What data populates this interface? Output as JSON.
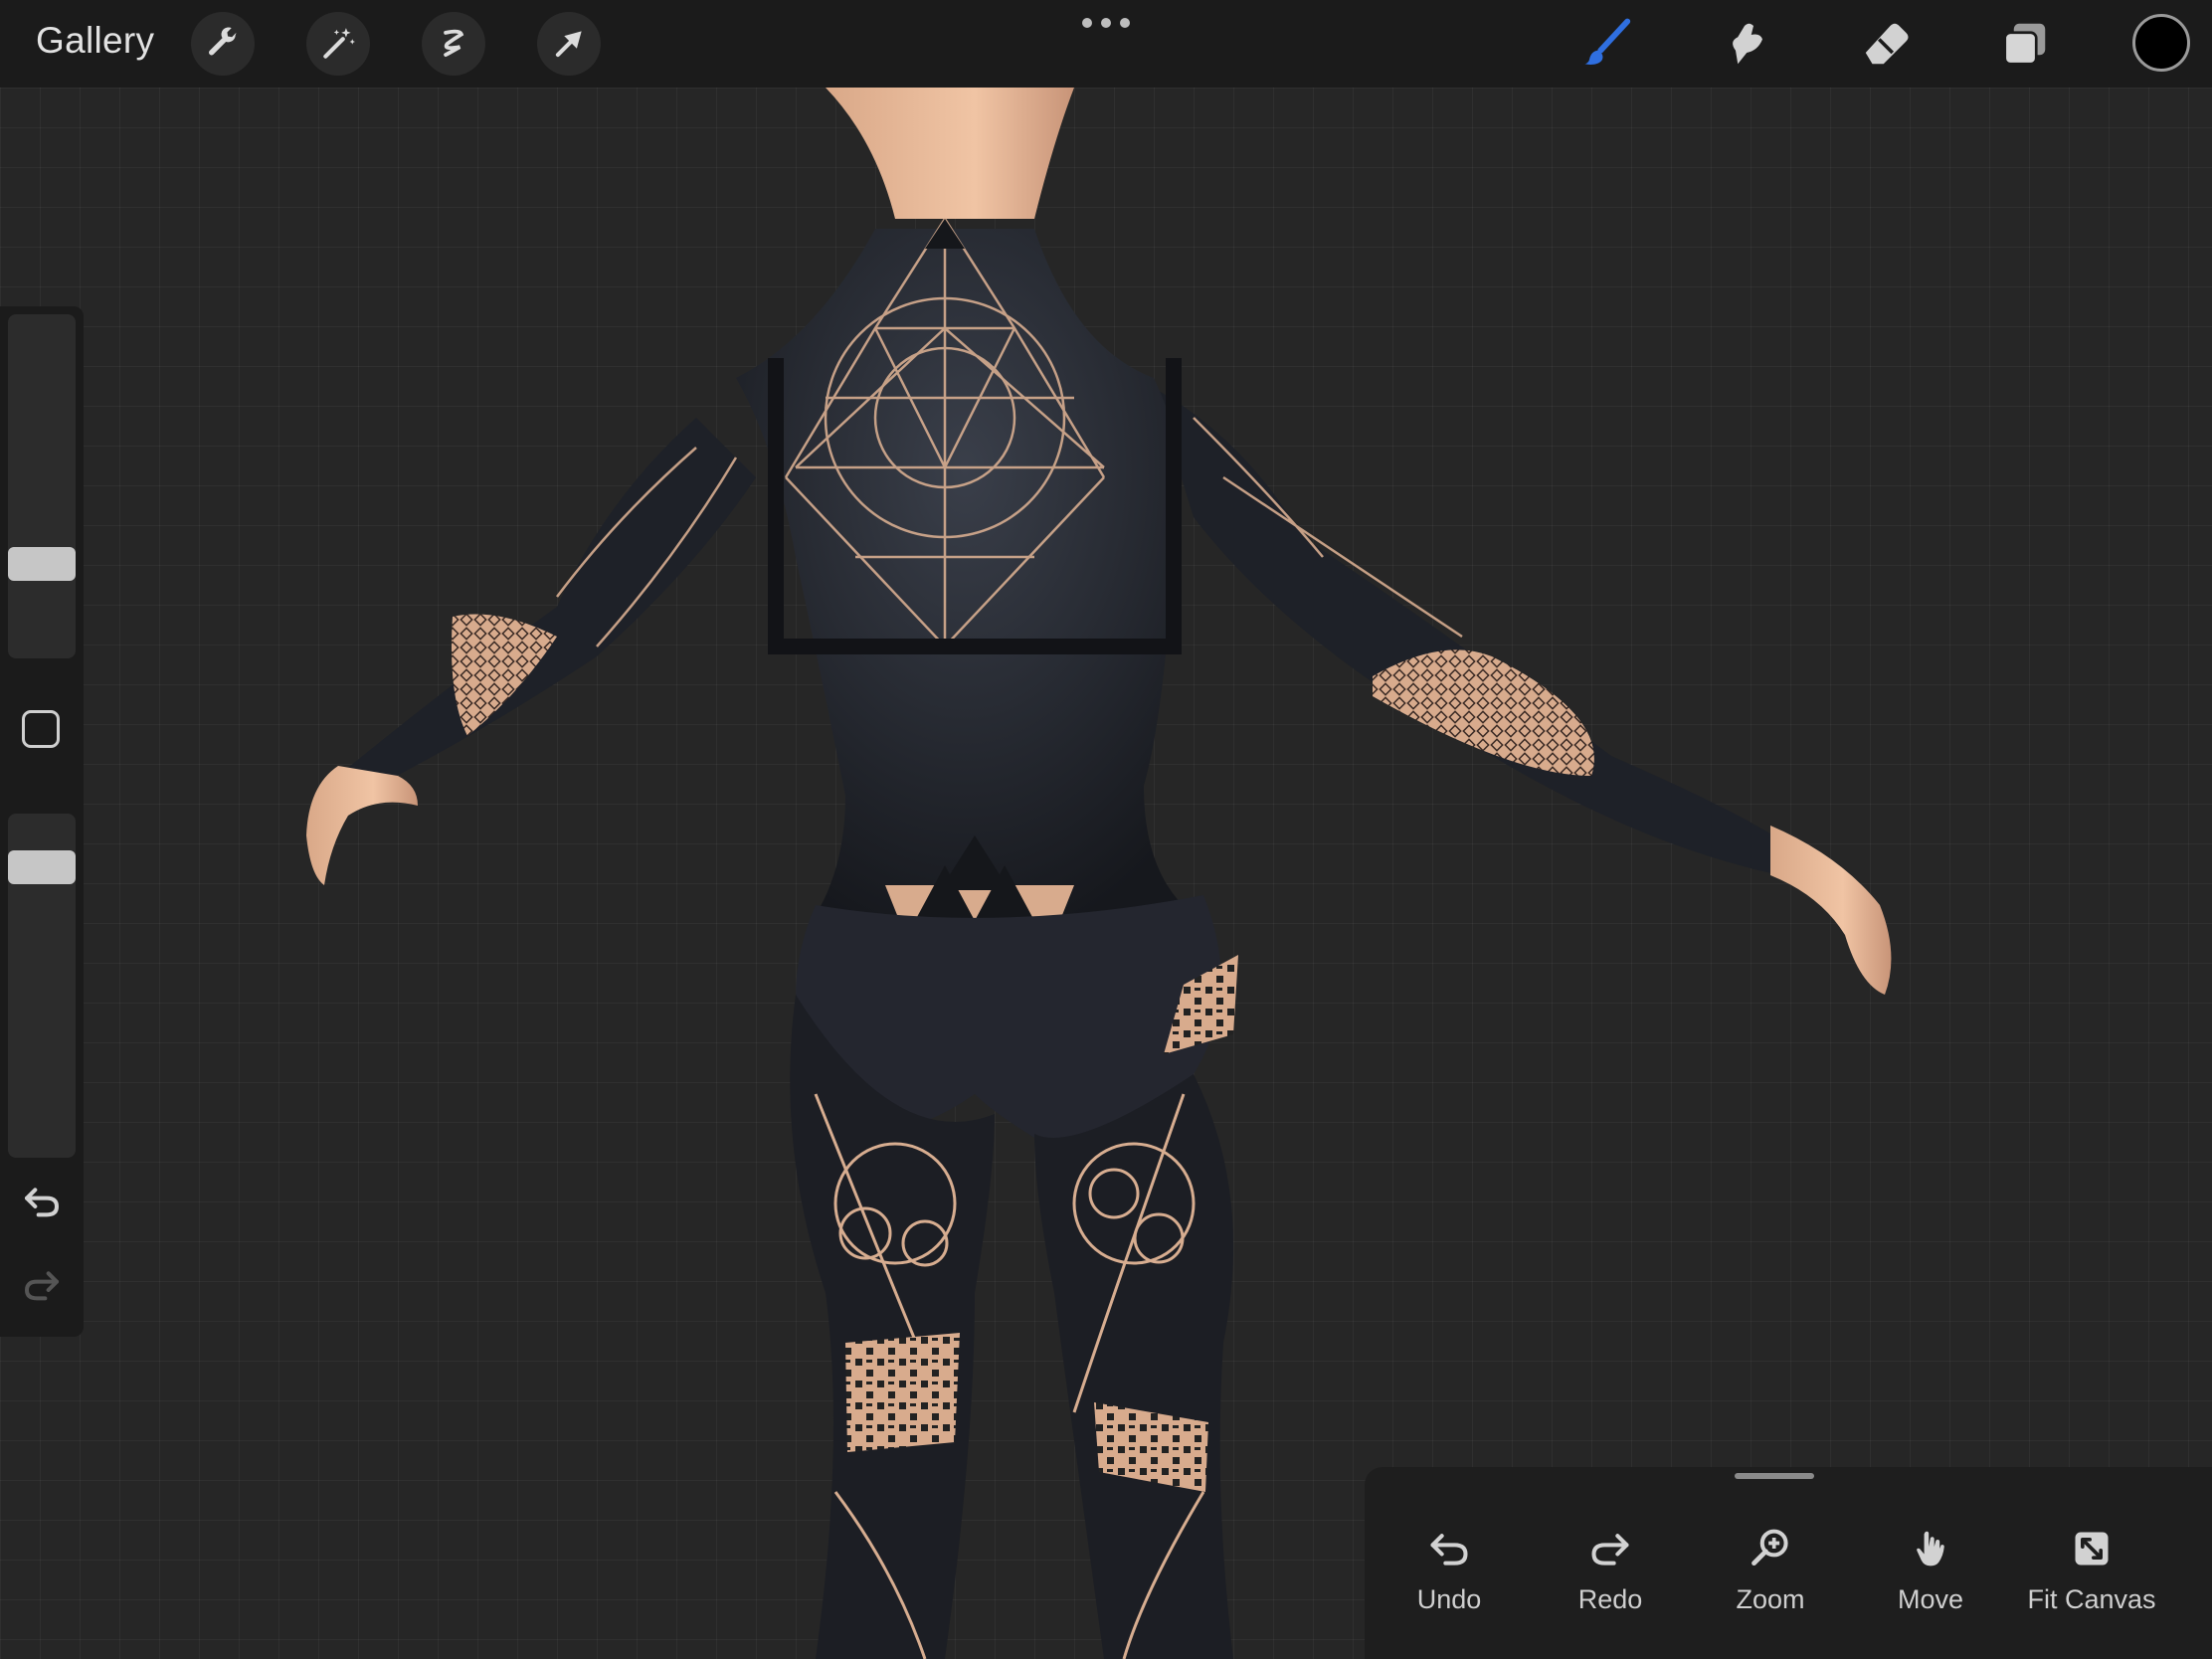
{
  "topbar": {
    "gallery_label": "Gallery",
    "left_tools": [
      "wrench-icon",
      "magic-wand-icon",
      "selection-icon",
      "transform-arrow-icon"
    ],
    "right_tools": [
      "brush-icon",
      "smudge-icon",
      "eraser-icon",
      "layers-icon"
    ],
    "active_tool": "brush-icon",
    "active_color": "#000000",
    "accent_color": "#2f6fe0"
  },
  "sidebar": {
    "brush_size_level": 0.25,
    "opacity_level": 0.88
  },
  "quick_menu": {
    "items": [
      {
        "icon": "undo-icon",
        "label": "Undo"
      },
      {
        "icon": "redo-icon",
        "label": "Redo"
      },
      {
        "icon": "zoom-icon",
        "label": "Zoom"
      },
      {
        "icon": "move-hand-icon",
        "label": "Move"
      },
      {
        "icon": "fit-canvas-icon",
        "label": "Fit Canvas"
      }
    ]
  }
}
